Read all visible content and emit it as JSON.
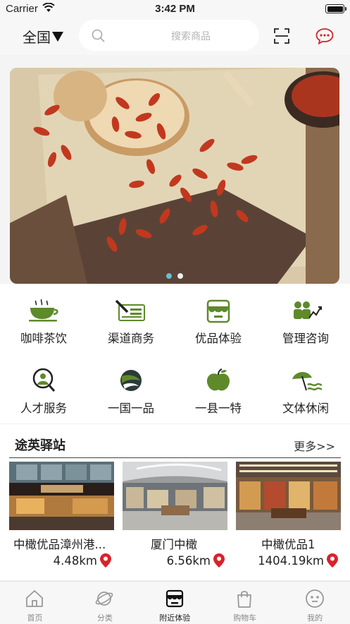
{
  "status_bar": {
    "carrier": "Carrier",
    "time": "3:42 PM"
  },
  "header": {
    "region": "全国",
    "search_placeholder": "搜索商品"
  },
  "banner": {
    "slide_count": 2,
    "active_slide": 1
  },
  "categories": [
    {
      "label": "咖啡茶饮",
      "icon": "coffee-cup-icon"
    },
    {
      "label": "渠道商务",
      "icon": "business-card-icon"
    },
    {
      "label": "优品体验",
      "icon": "store-icon"
    },
    {
      "label": "管理咨询",
      "icon": "consulting-icon"
    },
    {
      "label": "人才服务",
      "icon": "talent-search-icon"
    },
    {
      "label": "一国一品",
      "icon": "globe-icon"
    },
    {
      "label": "一县一特",
      "icon": "apple-icon"
    },
    {
      "label": "文体休闲",
      "icon": "leisure-icon"
    }
  ],
  "station": {
    "title": "途英驿站",
    "more": "更多>>",
    "stores": [
      {
        "name": "中橄优品漳州港...",
        "distance": "4.48km"
      },
      {
        "name": "厦门中橄",
        "distance": "6.56km"
      },
      {
        "name": "中橄优品1",
        "distance": "1404.19km"
      }
    ]
  },
  "tabs": [
    {
      "label": "首页",
      "icon": "home-icon",
      "active": false
    },
    {
      "label": "分类",
      "icon": "category-planet-icon",
      "active": false
    },
    {
      "label": "附近体验",
      "icon": "nearby-store-icon",
      "active": true
    },
    {
      "label": "购物车",
      "icon": "shopping-bag-icon",
      "active": false
    },
    {
      "label": "我的",
      "icon": "profile-face-icon",
      "active": false
    }
  ],
  "colors": {
    "accent_green": "#5e8a2a",
    "accent_red": "#d9222a",
    "dot_active": "#6bbcd3"
  }
}
